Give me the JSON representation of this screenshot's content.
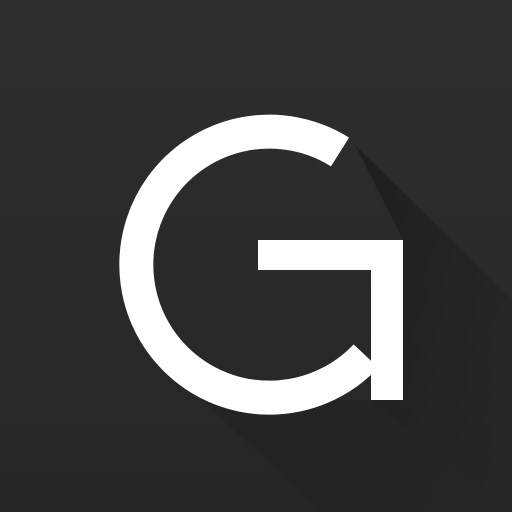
{
  "icon": {
    "name": "G",
    "glyph": "letter-g-arrow-icon",
    "colors": {
      "background_top": "#2e2e2e",
      "background_bottom": "#262626",
      "long_shadow": "#1a1a1a",
      "glyph": "#ffffff"
    }
  }
}
